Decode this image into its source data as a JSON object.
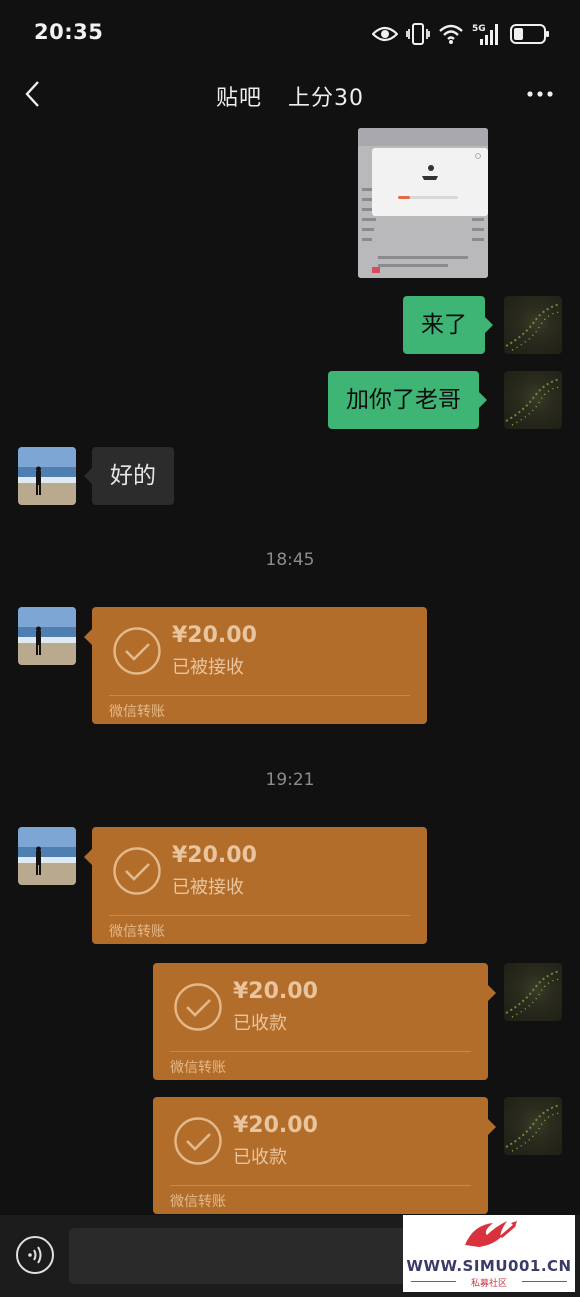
{
  "status_bar": {
    "time": "20:35",
    "network": "5G"
  },
  "nav": {
    "title_left": "贴吧",
    "title_right": "上分30"
  },
  "messages": {
    "m1": "来了",
    "m2": "加你了老哥",
    "m3": "好的"
  },
  "timestamps": {
    "t1": "18:45",
    "t2": "19:21"
  },
  "transfers": [
    {
      "amount": "¥20.00",
      "state": "已被接收",
      "label": "微信转账"
    },
    {
      "amount": "¥20.00",
      "state": "已被接收",
      "label": "微信转账"
    },
    {
      "amount": "¥20.00",
      "state": "已收款",
      "label": "微信转账"
    },
    {
      "amount": "¥20.00",
      "state": "已收款",
      "label": "微信转账"
    }
  ],
  "watermark": {
    "site": "WWW.SIMU001.CN",
    "tagline": "私募社区"
  },
  "colors": {
    "bubble_out": "#3eb575",
    "transfer": "#b26d2b",
    "background": "#111111"
  }
}
